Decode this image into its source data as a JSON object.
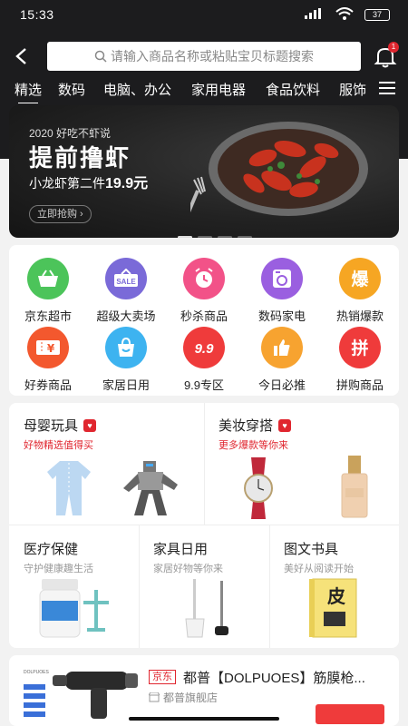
{
  "status": {
    "time": "15:33",
    "battery": "37"
  },
  "search": {
    "placeholder": "请输入商品名称或粘贴宝贝标题搜索"
  },
  "notifications": {
    "count": "1"
  },
  "categories": [
    "精选",
    "数码",
    "电脑、办公",
    "家用电器",
    "食品饮料",
    "服饰"
  ],
  "banner": {
    "year_text": "2020 好吃不虾说",
    "headline": "提前撸虾",
    "subtitle_prefix": "小龙虾第二件",
    "subtitle_price": "19.9元",
    "button_label": "立即抢购 ›",
    "slide_count": 4,
    "active_slide": 1
  },
  "grid": [
    {
      "label": "京东超市",
      "icon": "basket-icon",
      "color": "#4cc45a",
      "glyph": "🧺"
    },
    {
      "label": "超级大卖场",
      "icon": "sale-sign-icon",
      "color": "#7a6ad8",
      "glyph": "SALE"
    },
    {
      "label": "秒杀商品",
      "icon": "alarm-clock-icon",
      "color": "#f25288",
      "glyph": "⏰"
    },
    {
      "label": "数码家电",
      "icon": "washing-machine-icon",
      "color": "#9a5fe0",
      "glyph": "▣"
    },
    {
      "label": "热销爆款",
      "icon": "hot-sale-icon",
      "color": "#f6a623",
      "glyph": "爆"
    },
    {
      "label": "好券商品",
      "icon": "coupon-icon",
      "color": "#f3582e",
      "glyph": "¥"
    },
    {
      "label": "家居日用",
      "icon": "shopping-bag-icon",
      "color": "#3db3f0",
      "glyph": "👜"
    },
    {
      "label": "9.9专区",
      "icon": "nine-nine-icon",
      "color": "#ef3b3b",
      "glyph": "9.9"
    },
    {
      "label": "今日必推",
      "icon": "thumbs-up-icon",
      "color": "#f7a330",
      "glyph": "👍"
    },
    {
      "label": "拼购商品",
      "icon": "group-buy-icon",
      "color": "#ef3b3b",
      "glyph": "拼"
    }
  ],
  "promo": {
    "mother_baby": {
      "title": "母婴玩具",
      "subtitle": "好物精选值得买"
    },
    "beauty": {
      "title": "美妆穿搭",
      "subtitle": "更多爆款等你来"
    },
    "health": {
      "title": "医疗保健",
      "subtitle": "守护健康趣生活"
    },
    "home": {
      "title": "家具日用",
      "subtitle": "家居好物等你来"
    },
    "books": {
      "title": "图文书具",
      "subtitle": "美好从阅读开始"
    }
  },
  "product": {
    "store_tag": "京东",
    "name": "都普【DOLPUOES】筋膜枪...",
    "shop": "都普旗舰店"
  }
}
